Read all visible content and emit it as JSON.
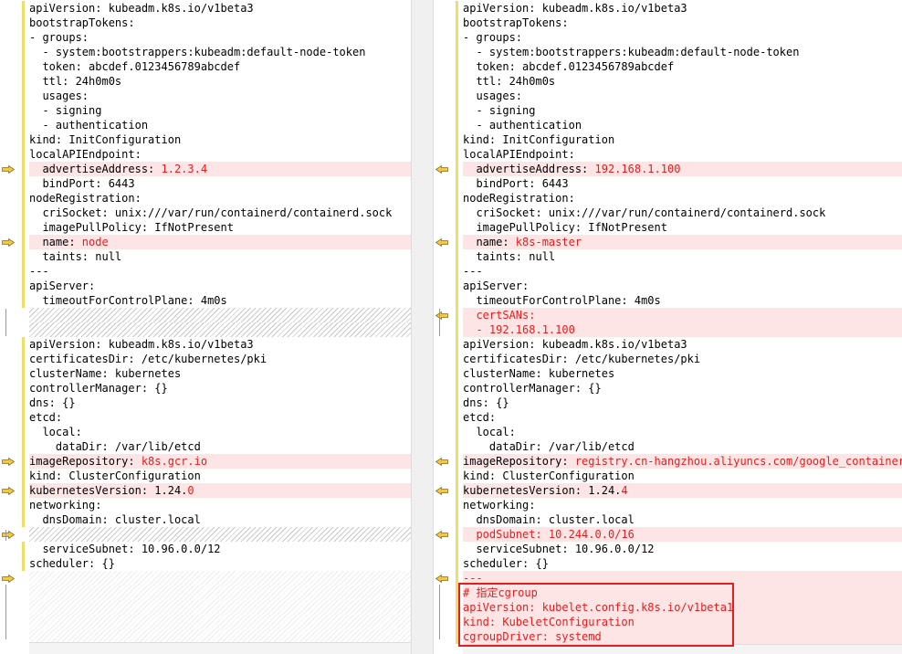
{
  "left_pane": {
    "block1": [
      {
        "k": "apiVersion: ",
        "v": "kubeadm.k8s.io/v1beta3",
        "t": "same"
      },
      {
        "k": "bootstrapTokens:",
        "v": "",
        "t": "same"
      },
      {
        "k": "- groups:",
        "v": "",
        "t": "same"
      },
      {
        "k": "  - system:bootstrappers:kubeadm:default-node-token",
        "v": "",
        "t": "same"
      },
      {
        "k": "  token: abcdef.0123456789abcdef",
        "v": "",
        "t": "same"
      },
      {
        "k": "  ttl: 24h0m0s",
        "v": "",
        "t": "same"
      },
      {
        "k": "  usages:",
        "v": "",
        "t": "same"
      },
      {
        "k": "  - signing",
        "v": "",
        "t": "same"
      },
      {
        "k": "  - authentication",
        "v": "",
        "t": "same"
      },
      {
        "k": "kind: InitConfiguration",
        "v": "",
        "t": "same"
      },
      {
        "k": "localAPIEndpoint:",
        "v": "",
        "t": "same"
      },
      {
        "k": "  advertiseAddress: ",
        "v": "1.2.3.4",
        "t": "changed"
      },
      {
        "k": "  bindPort: 6443",
        "v": "",
        "t": "same"
      },
      {
        "k": "nodeRegistration:",
        "v": "",
        "t": "same"
      },
      {
        "k": "  criSocket: unix:///var/run/containerd/containerd.sock",
        "v": "",
        "t": "same"
      },
      {
        "k": "  imagePullPolicy: IfNotPresent",
        "v": "",
        "t": "same"
      },
      {
        "k": "  name: ",
        "v": "node",
        "t": "changed"
      },
      {
        "k": "  taints: null",
        "v": "",
        "t": "same"
      },
      {
        "k": "---",
        "v": "",
        "t": "same"
      },
      {
        "k": "apiServer:",
        "v": "",
        "t": "same"
      },
      {
        "k": "  timeoutForControlPlane: 4m0s",
        "v": "",
        "t": "same"
      }
    ],
    "block2": [
      {
        "k": "apiVersion: kubeadm.k8s.io/v1beta3",
        "v": "",
        "t": "same"
      },
      {
        "k": "certificatesDir: /etc/kubernetes/pki",
        "v": "",
        "t": "same"
      },
      {
        "k": "clusterName: kubernetes",
        "v": "",
        "t": "same"
      },
      {
        "k": "controllerManager: {}",
        "v": "",
        "t": "same"
      },
      {
        "k": "dns: {}",
        "v": "",
        "t": "same"
      },
      {
        "k": "etcd:",
        "v": "",
        "t": "same"
      },
      {
        "k": "  local:",
        "v": "",
        "t": "same"
      },
      {
        "k": "    dataDir: /var/lib/etcd",
        "v": "",
        "t": "same"
      },
      {
        "k": "imageRepository: ",
        "v": "k8s.gcr.io",
        "t": "changed"
      },
      {
        "k": "kind: ClusterConfiguration",
        "v": "",
        "t": "same"
      },
      {
        "k": "kubernetesVersion: 1.24.",
        "v": "0",
        "t": "changed"
      },
      {
        "k": "networking:",
        "v": "",
        "t": "same"
      },
      {
        "k": "  dnsDomain: cluster.local",
        "v": "",
        "t": "same"
      }
    ],
    "block3": [
      {
        "k": "  serviceSubnet: 10.96.0.0/12",
        "v": "",
        "t": "same"
      },
      {
        "k": "scheduler: {}",
        "v": "",
        "t": "same"
      }
    ]
  },
  "right_pane": {
    "block1": [
      {
        "k": "apiVersion: ",
        "v": "kubeadm.k8s.io/v1beta3",
        "t": "same"
      },
      {
        "k": "bootstrapTokens:",
        "v": "",
        "t": "same"
      },
      {
        "k": "- groups:",
        "v": "",
        "t": "same"
      },
      {
        "k": "  - system:bootstrappers:kubeadm:default-node-token",
        "v": "",
        "t": "same"
      },
      {
        "k": "  token: abcdef.0123456789abcdef",
        "v": "",
        "t": "same"
      },
      {
        "k": "  ttl: 24h0m0s",
        "v": "",
        "t": "same"
      },
      {
        "k": "  usages:",
        "v": "",
        "t": "same"
      },
      {
        "k": "  - signing",
        "v": "",
        "t": "same"
      },
      {
        "k": "  - authentication",
        "v": "",
        "t": "same"
      },
      {
        "k": "kind: InitConfiguration",
        "v": "",
        "t": "same"
      },
      {
        "k": "localAPIEndpoint:",
        "v": "",
        "t": "same"
      },
      {
        "k": "  advertiseAddress: ",
        "v": "192.168.1.100",
        "t": "changed"
      },
      {
        "k": "  bindPort: 6443",
        "v": "",
        "t": "same"
      },
      {
        "k": "nodeRegistration:",
        "v": "",
        "t": "same"
      },
      {
        "k": "  criSocket: unix:///var/run/containerd/containerd.sock",
        "v": "",
        "t": "same"
      },
      {
        "k": "  imagePullPolicy: IfNotPresent",
        "v": "",
        "t": "same"
      },
      {
        "k": "  name: ",
        "v": "k8s-master",
        "t": "changed"
      },
      {
        "k": "  taints: null",
        "v": "",
        "t": "same"
      },
      {
        "k": "---",
        "v": "",
        "t": "same"
      },
      {
        "k": "apiServer:",
        "v": "",
        "t": "same"
      },
      {
        "k": "  timeoutForControlPlane: 4m0s",
        "v": "",
        "t": "same"
      },
      {
        "k": "  certSANs:",
        "v": "",
        "t": "added"
      },
      {
        "k": "  - 192.168.1.100",
        "v": "",
        "t": "added"
      },
      {
        "k": "apiVersion: kubeadm.k8s.io/v1beta3",
        "v": "",
        "t": "same"
      },
      {
        "k": "certificatesDir: /etc/kubernetes/pki",
        "v": "",
        "t": "same"
      },
      {
        "k": "clusterName: kubernetes",
        "v": "",
        "t": "same"
      },
      {
        "k": "controllerManager: {}",
        "v": "",
        "t": "same"
      },
      {
        "k": "dns: {}",
        "v": "",
        "t": "same"
      },
      {
        "k": "etcd:",
        "v": "",
        "t": "same"
      },
      {
        "k": "  local:",
        "v": "",
        "t": "same"
      },
      {
        "k": "    dataDir: /var/lib/etcd",
        "v": "",
        "t": "same"
      },
      {
        "k": "imageRepository: ",
        "v": "registry.cn-hangzhou.aliyuncs.com/google_containers",
        "t": "changed"
      },
      {
        "k": "kind: ClusterConfiguration",
        "v": "",
        "t": "same"
      },
      {
        "k": "kubernetesVersion: 1.24.",
        "v": "4",
        "t": "changed"
      },
      {
        "k": "networking:",
        "v": "",
        "t": "same"
      },
      {
        "k": "  dnsDomain: cluster.local",
        "v": "",
        "t": "same"
      },
      {
        "k": "  podSubnet: 10.244.0.0/16",
        "v": "",
        "t": "added"
      },
      {
        "k": "  serviceSubnet: 10.96.0.0/12",
        "v": "",
        "t": "same"
      },
      {
        "k": "scheduler: {}",
        "v": "",
        "t": "same"
      },
      {
        "k": "---",
        "v": "",
        "t": "added"
      },
      {
        "k": "# 指定cgroup",
        "v": "",
        "t": "added"
      },
      {
        "k": "apiVersion: kubelet.config.k8s.io/v1beta1",
        "v": "",
        "t": "added"
      },
      {
        "k": "kind: KubeletConfiguration",
        "v": "",
        "t": "added"
      },
      {
        "k": "cgroupDriver: systemd",
        "v": "",
        "t": "added"
      }
    ]
  },
  "colors": {
    "changed_bg": "#fde5e5",
    "changed_text": "#e02020",
    "change_bar": "#f2dc68",
    "arrow_fill": "#f5c842"
  }
}
